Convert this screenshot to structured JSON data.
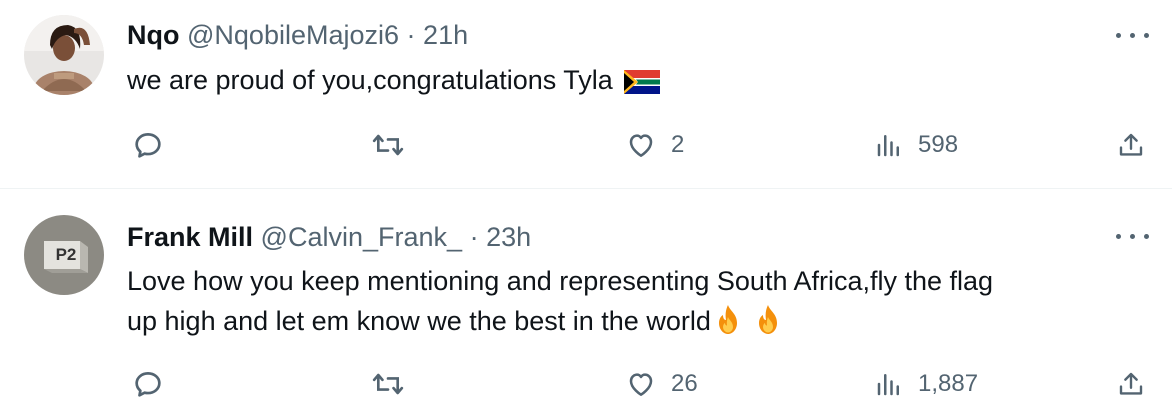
{
  "tweets": [
    {
      "display_name": "Nqo",
      "handle": "@NqobileMajozi6",
      "separator": "·",
      "time": "21h",
      "text": "we are proud of you,congratulations Tyla",
      "emoji": [
        "south-africa-flag"
      ],
      "avatar": "photo",
      "likes": "2",
      "views": "598"
    },
    {
      "display_name": "Frank Mill",
      "handle": "@Calvin_Frank_",
      "separator": "·",
      "time": "23h",
      "text_line1": "Love how you keep mentioning and representing South Africa,fly the flag",
      "text_line2": "up high and let em know we the best in the world",
      "emoji": [
        "fire",
        "fire"
      ],
      "avatar_text": "P2",
      "likes": "26",
      "views": "1,887"
    }
  ],
  "colors": {
    "text": "#0f1419",
    "secondary": "#536471",
    "divider": "#eff3f4"
  }
}
